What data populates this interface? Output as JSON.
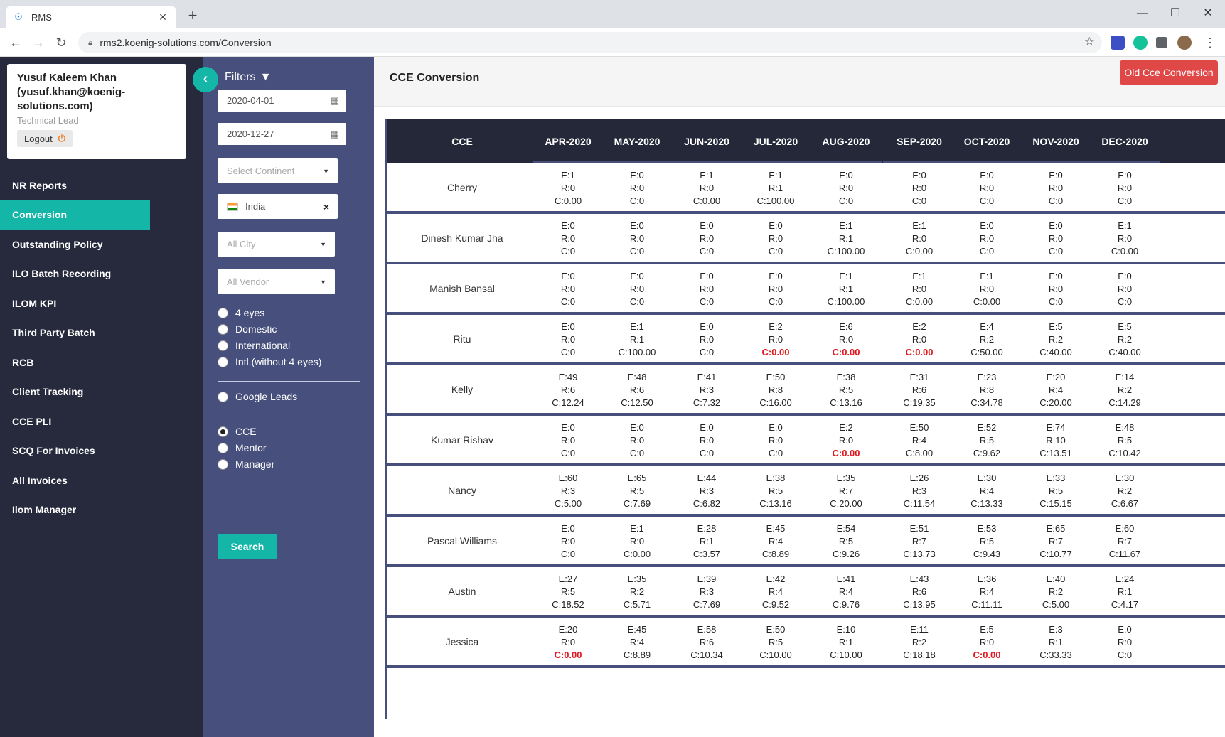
{
  "browser": {
    "tab_title": "RMS",
    "url": "rms2.koenig-solutions.com/Conversion"
  },
  "user": {
    "name_line1": "Yusuf Kaleem Khan",
    "name_line2": "(yusuf.khan@koenig-",
    "name_line3": "solutions.com)",
    "role": "Technical Lead",
    "logout_label": "Logout"
  },
  "nav": {
    "items": [
      "NR Reports",
      "Conversion",
      "Outstanding Policy",
      "ILO Batch Recording",
      "ILOM KPI",
      "Third Party Batch",
      "RCB",
      "Client Tracking",
      "CCE PLI",
      "SCQ For Invoices",
      "All Invoices",
      "Ilom Manager"
    ],
    "active_index": 1
  },
  "filters": {
    "title": "Filters",
    "from_date": "2020-04-01",
    "to_date": "2020-12-27",
    "continent_placeholder": "Select Continent",
    "country_value": "India",
    "city_placeholder": "All City",
    "vendor_placeholder": "All Vendor",
    "type_options": [
      "4 eyes",
      "Domestic",
      "International",
      "Intl.(without 4 eyes)"
    ],
    "google_leads_label": "Google Leads",
    "role_options": [
      "CCE",
      "Mentor",
      "Manager"
    ],
    "role_selected_index": 0,
    "search_label": "Search"
  },
  "page": {
    "title": "CCE Conversion",
    "old_button_label": "Old Cce Conversion"
  },
  "table": {
    "first_column_header": "CCE",
    "months": [
      "APR-2020",
      "MAY-2020",
      "JUN-2020",
      "JUL-2020",
      "AUG-2020",
      "SEP-2020",
      "OCT-2020",
      "NOV-2020",
      "DEC-2020"
    ],
    "rows": [
      {
        "name": "Cherry",
        "cells": [
          {
            "e": "E:1",
            "r": "R:0",
            "c": "C:0.00",
            "red": false
          },
          {
            "e": "E:0",
            "r": "R:0",
            "c": "C:0",
            "red": false
          },
          {
            "e": "E:1",
            "r": "R:0",
            "c": "C:0.00",
            "red": false
          },
          {
            "e": "E:1",
            "r": "R:1",
            "c": "C:100.00",
            "red": false
          },
          {
            "e": "E:0",
            "r": "R:0",
            "c": "C:0",
            "red": false
          },
          {
            "e": "E:0",
            "r": "R:0",
            "c": "C:0",
            "red": false
          },
          {
            "e": "E:0",
            "r": "R:0",
            "c": "C:0",
            "red": false
          },
          {
            "e": "E:0",
            "r": "R:0",
            "c": "C:0",
            "red": false
          },
          {
            "e": "E:0",
            "r": "R:0",
            "c": "C:0",
            "red": false
          }
        ]
      },
      {
        "name": "Dinesh Kumar Jha",
        "cells": [
          {
            "e": "E:0",
            "r": "R:0",
            "c": "C:0",
            "red": false
          },
          {
            "e": "E:0",
            "r": "R:0",
            "c": "C:0",
            "red": false
          },
          {
            "e": "E:0",
            "r": "R:0",
            "c": "C:0",
            "red": false
          },
          {
            "e": "E:0",
            "r": "R:0",
            "c": "C:0",
            "red": false
          },
          {
            "e": "E:1",
            "r": "R:1",
            "c": "C:100.00",
            "red": false
          },
          {
            "e": "E:1",
            "r": "R:0",
            "c": "C:0.00",
            "red": false
          },
          {
            "e": "E:0",
            "r": "R:0",
            "c": "C:0",
            "red": false
          },
          {
            "e": "E:0",
            "r": "R:0",
            "c": "C:0",
            "red": false
          },
          {
            "e": "E:1",
            "r": "R:0",
            "c": "C:0.00",
            "red": false
          }
        ]
      },
      {
        "name": "Manish Bansal",
        "cells": [
          {
            "e": "E:0",
            "r": "R:0",
            "c": "C:0",
            "red": false
          },
          {
            "e": "E:0",
            "r": "R:0",
            "c": "C:0",
            "red": false
          },
          {
            "e": "E:0",
            "r": "R:0",
            "c": "C:0",
            "red": false
          },
          {
            "e": "E:0",
            "r": "R:0",
            "c": "C:0",
            "red": false
          },
          {
            "e": "E:1",
            "r": "R:1",
            "c": "C:100.00",
            "red": false
          },
          {
            "e": "E:1",
            "r": "R:0",
            "c": "C:0.00",
            "red": false
          },
          {
            "e": "E:1",
            "r": "R:0",
            "c": "C:0.00",
            "red": false
          },
          {
            "e": "E:0",
            "r": "R:0",
            "c": "C:0",
            "red": false
          },
          {
            "e": "E:0",
            "r": "R:0",
            "c": "C:0",
            "red": false
          }
        ]
      },
      {
        "name": "Ritu",
        "cells": [
          {
            "e": "E:0",
            "r": "R:0",
            "c": "C:0",
            "red": false
          },
          {
            "e": "E:1",
            "r": "R:1",
            "c": "C:100.00",
            "red": false
          },
          {
            "e": "E:0",
            "r": "R:0",
            "c": "C:0",
            "red": false
          },
          {
            "e": "E:2",
            "r": "R:0",
            "c": "C:0.00",
            "red": true
          },
          {
            "e": "E:6",
            "r": "R:0",
            "c": "C:0.00",
            "red": true
          },
          {
            "e": "E:2",
            "r": "R:0",
            "c": "C:0.00",
            "red": true
          },
          {
            "e": "E:4",
            "r": "R:2",
            "c": "C:50.00",
            "red": false
          },
          {
            "e": "E:5",
            "r": "R:2",
            "c": "C:40.00",
            "red": false
          },
          {
            "e": "E:5",
            "r": "R:2",
            "c": "C:40.00",
            "red": false
          }
        ]
      },
      {
        "name": "Kelly",
        "cells": [
          {
            "e": "E:49",
            "r": "R:6",
            "c": "C:12.24",
            "red": false
          },
          {
            "e": "E:48",
            "r": "R:6",
            "c": "C:12.50",
            "red": false
          },
          {
            "e": "E:41",
            "r": "R:3",
            "c": "C:7.32",
            "red": false
          },
          {
            "e": "E:50",
            "r": "R:8",
            "c": "C:16.00",
            "red": false
          },
          {
            "e": "E:38",
            "r": "R:5",
            "c": "C:13.16",
            "red": false
          },
          {
            "e": "E:31",
            "r": "R:6",
            "c": "C:19.35",
            "red": false
          },
          {
            "e": "E:23",
            "r": "R:8",
            "c": "C:34.78",
            "red": false
          },
          {
            "e": "E:20",
            "r": "R:4",
            "c": "C:20.00",
            "red": false
          },
          {
            "e": "E:14",
            "r": "R:2",
            "c": "C:14.29",
            "red": false
          }
        ]
      },
      {
        "name": "Kumar Rishav",
        "cells": [
          {
            "e": "E:0",
            "r": "R:0",
            "c": "C:0",
            "red": false
          },
          {
            "e": "E:0",
            "r": "R:0",
            "c": "C:0",
            "red": false
          },
          {
            "e": "E:0",
            "r": "R:0",
            "c": "C:0",
            "red": false
          },
          {
            "e": "E:0",
            "r": "R:0",
            "c": "C:0",
            "red": false
          },
          {
            "e": "E:2",
            "r": "R:0",
            "c": "C:0.00",
            "red": true
          },
          {
            "e": "E:50",
            "r": "R:4",
            "c": "C:8.00",
            "red": false
          },
          {
            "e": "E:52",
            "r": "R:5",
            "c": "C:9.62",
            "red": false
          },
          {
            "e": "E:74",
            "r": "R:10",
            "c": "C:13.51",
            "red": false
          },
          {
            "e": "E:48",
            "r": "R:5",
            "c": "C:10.42",
            "red": false
          }
        ]
      },
      {
        "name": "Nancy",
        "cells": [
          {
            "e": "E:60",
            "r": "R:3",
            "c": "C:5.00",
            "red": false
          },
          {
            "e": "E:65",
            "r": "R:5",
            "c": "C:7.69",
            "red": false
          },
          {
            "e": "E:44",
            "r": "R:3",
            "c": "C:6.82",
            "red": false
          },
          {
            "e": "E:38",
            "r": "R:5",
            "c": "C:13.16",
            "red": false
          },
          {
            "e": "E:35",
            "r": "R:7",
            "c": "C:20.00",
            "red": false
          },
          {
            "e": "E:26",
            "r": "R:3",
            "c": "C:11.54",
            "red": false
          },
          {
            "e": "E:30",
            "r": "R:4",
            "c": "C:13.33",
            "red": false
          },
          {
            "e": "E:33",
            "r": "R:5",
            "c": "C:15.15",
            "red": false
          },
          {
            "e": "E:30",
            "r": "R:2",
            "c": "C:6.67",
            "red": false
          }
        ]
      },
      {
        "name": "Pascal Williams",
        "cells": [
          {
            "e": "E:0",
            "r": "R:0",
            "c": "C:0",
            "red": false
          },
          {
            "e": "E:1",
            "r": "R:0",
            "c": "C:0.00",
            "red": false
          },
          {
            "e": "E:28",
            "r": "R:1",
            "c": "C:3.57",
            "red": false
          },
          {
            "e": "E:45",
            "r": "R:4",
            "c": "C:8.89",
            "red": false
          },
          {
            "e": "E:54",
            "r": "R:5",
            "c": "C:9.26",
            "red": false
          },
          {
            "e": "E:51",
            "r": "R:7",
            "c": "C:13.73",
            "red": false
          },
          {
            "e": "E:53",
            "r": "R:5",
            "c": "C:9.43",
            "red": false
          },
          {
            "e": "E:65",
            "r": "R:7",
            "c": "C:10.77",
            "red": false
          },
          {
            "e": "E:60",
            "r": "R:7",
            "c": "C:11.67",
            "red": false
          }
        ]
      },
      {
        "name": "Austin",
        "cells": [
          {
            "e": "E:27",
            "r": "R:5",
            "c": "C:18.52",
            "red": false
          },
          {
            "e": "E:35",
            "r": "R:2",
            "c": "C:5.71",
            "red": false
          },
          {
            "e": "E:39",
            "r": "R:3",
            "c": "C:7.69",
            "red": false
          },
          {
            "e": "E:42",
            "r": "R:4",
            "c": "C:9.52",
            "red": false
          },
          {
            "e": "E:41",
            "r": "R:4",
            "c": "C:9.76",
            "red": false
          },
          {
            "e": "E:43",
            "r": "R:6",
            "c": "C:13.95",
            "red": false
          },
          {
            "e": "E:36",
            "r": "R:4",
            "c": "C:11.11",
            "red": false
          },
          {
            "e": "E:40",
            "r": "R:2",
            "c": "C:5.00",
            "red": false
          },
          {
            "e": "E:24",
            "r": "R:1",
            "c": "C:4.17",
            "red": false
          }
        ]
      },
      {
        "name": "Jessica",
        "cells": [
          {
            "e": "E:20",
            "r": "R:0",
            "c": "C:0.00",
            "red": true
          },
          {
            "e": "E:45",
            "r": "R:4",
            "c": "C:8.89",
            "red": false
          },
          {
            "e": "E:58",
            "r": "R:6",
            "c": "C:10.34",
            "red": false
          },
          {
            "e": "E:50",
            "r": "R:5",
            "c": "C:10.00",
            "red": false
          },
          {
            "e": "E:10",
            "r": "R:1",
            "c": "C:10.00",
            "red": false
          },
          {
            "e": "E:11",
            "r": "R:2",
            "c": "C:18.18",
            "red": false
          },
          {
            "e": "E:5",
            "r": "R:0",
            "c": "C:0.00",
            "red": true
          },
          {
            "e": "E:3",
            "r": "R:1",
            "c": "C:33.33",
            "red": false
          },
          {
            "e": "E:0",
            "r": "R:0",
            "c": "C:0",
            "red": false
          }
        ]
      }
    ]
  },
  "colors": {
    "accent": "#14b6a8",
    "nav_bg": "#262a3c",
    "filter_bg": "#474f7c",
    "table_head_bg": "#242839",
    "danger": "#e04848",
    "zero_conversion": "#e0171f"
  }
}
